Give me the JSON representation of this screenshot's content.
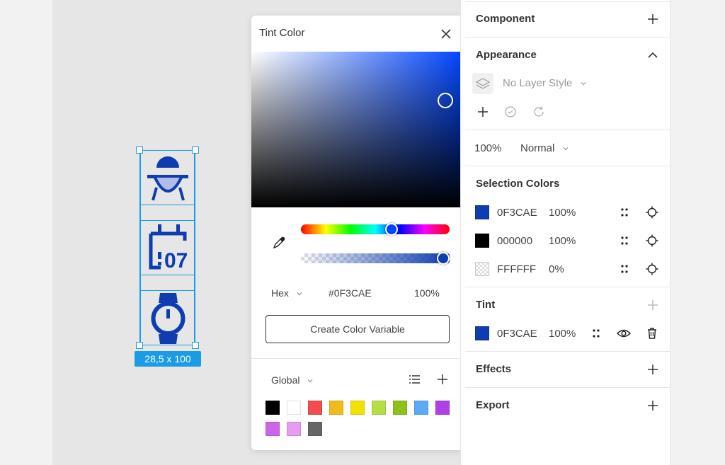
{
  "canvas": {
    "selection_size": "28,5 x 100",
    "icon_color": "#0F3CAE",
    "icon_07_text": "07"
  },
  "popup": {
    "title": "Tint Color",
    "hex_label": "Hex",
    "hex_value": "#0F3CAE",
    "opacity": "100%",
    "create_variable": "Create Color Variable",
    "library_label": "Global",
    "hue_fraction": 0.61,
    "alpha_fraction": 1.0,
    "swatches": [
      "#000000",
      "#FFFFFF",
      "#F24C4C",
      "#F2BB1D",
      "#F5E100",
      "#B3E046",
      "#8CC21A",
      "#5AABF2",
      "#B040E6",
      "#CC66E6",
      "#E69CF2",
      "#666666"
    ]
  },
  "panel": {
    "component": "Component",
    "appearance": "Appearance",
    "layer_style": "No Layer Style",
    "opacity": "100%",
    "blend_mode": "Normal",
    "selection_colors_title": "Selection Colors",
    "selection_colors": [
      {
        "hex": "0F3CAE",
        "opacity": "100%",
        "color": "#0F3CAE"
      },
      {
        "hex": "000000",
        "opacity": "100%",
        "color": "#000000"
      },
      {
        "hex": "FFFFFF",
        "opacity": "0%",
        "color": "#FFFFFF"
      }
    ],
    "tint_title": "Tint",
    "tint": {
      "hex": "0F3CAE",
      "opacity": "100%",
      "color": "#0F3CAE"
    },
    "effects": "Effects",
    "export": "Export"
  }
}
